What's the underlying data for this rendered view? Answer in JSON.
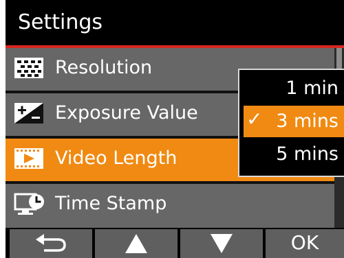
{
  "header": {
    "title": "Settings",
    "accent_color": "#d8261f"
  },
  "menu": {
    "items": [
      {
        "label": "Resolution",
        "icon": "resolution-grid-icon"
      },
      {
        "label": "Exposure Value",
        "icon": "exposure-plus-minus-icon"
      },
      {
        "label": "Video Length",
        "icon": "film-play-icon",
        "selected": true
      },
      {
        "label": "Time Stamp",
        "icon": "clock-monitor-icon"
      }
    ],
    "selected_color": "#f08a12"
  },
  "dropdown": {
    "options": [
      "1 min",
      "3 mins",
      "5 mins"
    ],
    "selected_check": "✓"
  },
  "footer": {
    "buttons": [
      {
        "icon": "back-arrow-icon"
      },
      {
        "icon": "up-triangle-icon"
      },
      {
        "icon": "down-triangle-icon"
      },
      {
        "label": "OK"
      }
    ]
  }
}
